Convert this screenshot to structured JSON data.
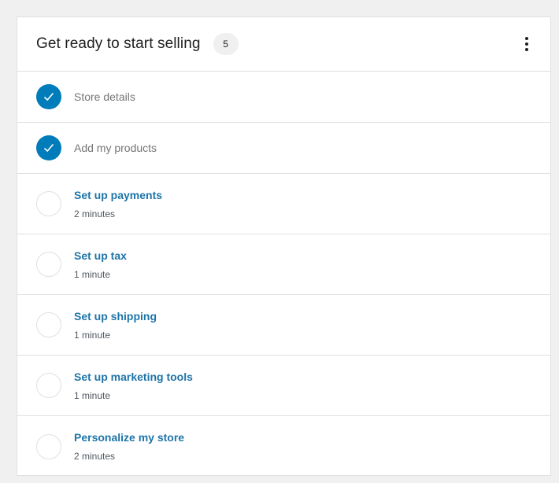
{
  "header": {
    "title": "Get ready to start selling",
    "count": "5"
  },
  "tasks": [
    {
      "title": "Store details",
      "completed": true
    },
    {
      "title": "Add my products",
      "completed": true
    },
    {
      "title": "Set up payments",
      "time": "2 minutes",
      "completed": false
    },
    {
      "title": "Set up tax",
      "time": "1 minute",
      "completed": false
    },
    {
      "title": "Set up shipping",
      "time": "1 minute",
      "completed": false
    },
    {
      "title": "Set up marketing tools",
      "time": "1 minute",
      "completed": false
    },
    {
      "title": "Personalize my store",
      "time": "2 minutes",
      "completed": false
    }
  ],
  "colors": {
    "accent": "#007cba",
    "link": "#1e74a8",
    "border": "#e0e0e0",
    "background": "#f0f0f1"
  },
  "icons": {
    "completed": "checkmark-icon",
    "pending": "empty-circle-icon",
    "menu": "more-vertical-icon"
  }
}
